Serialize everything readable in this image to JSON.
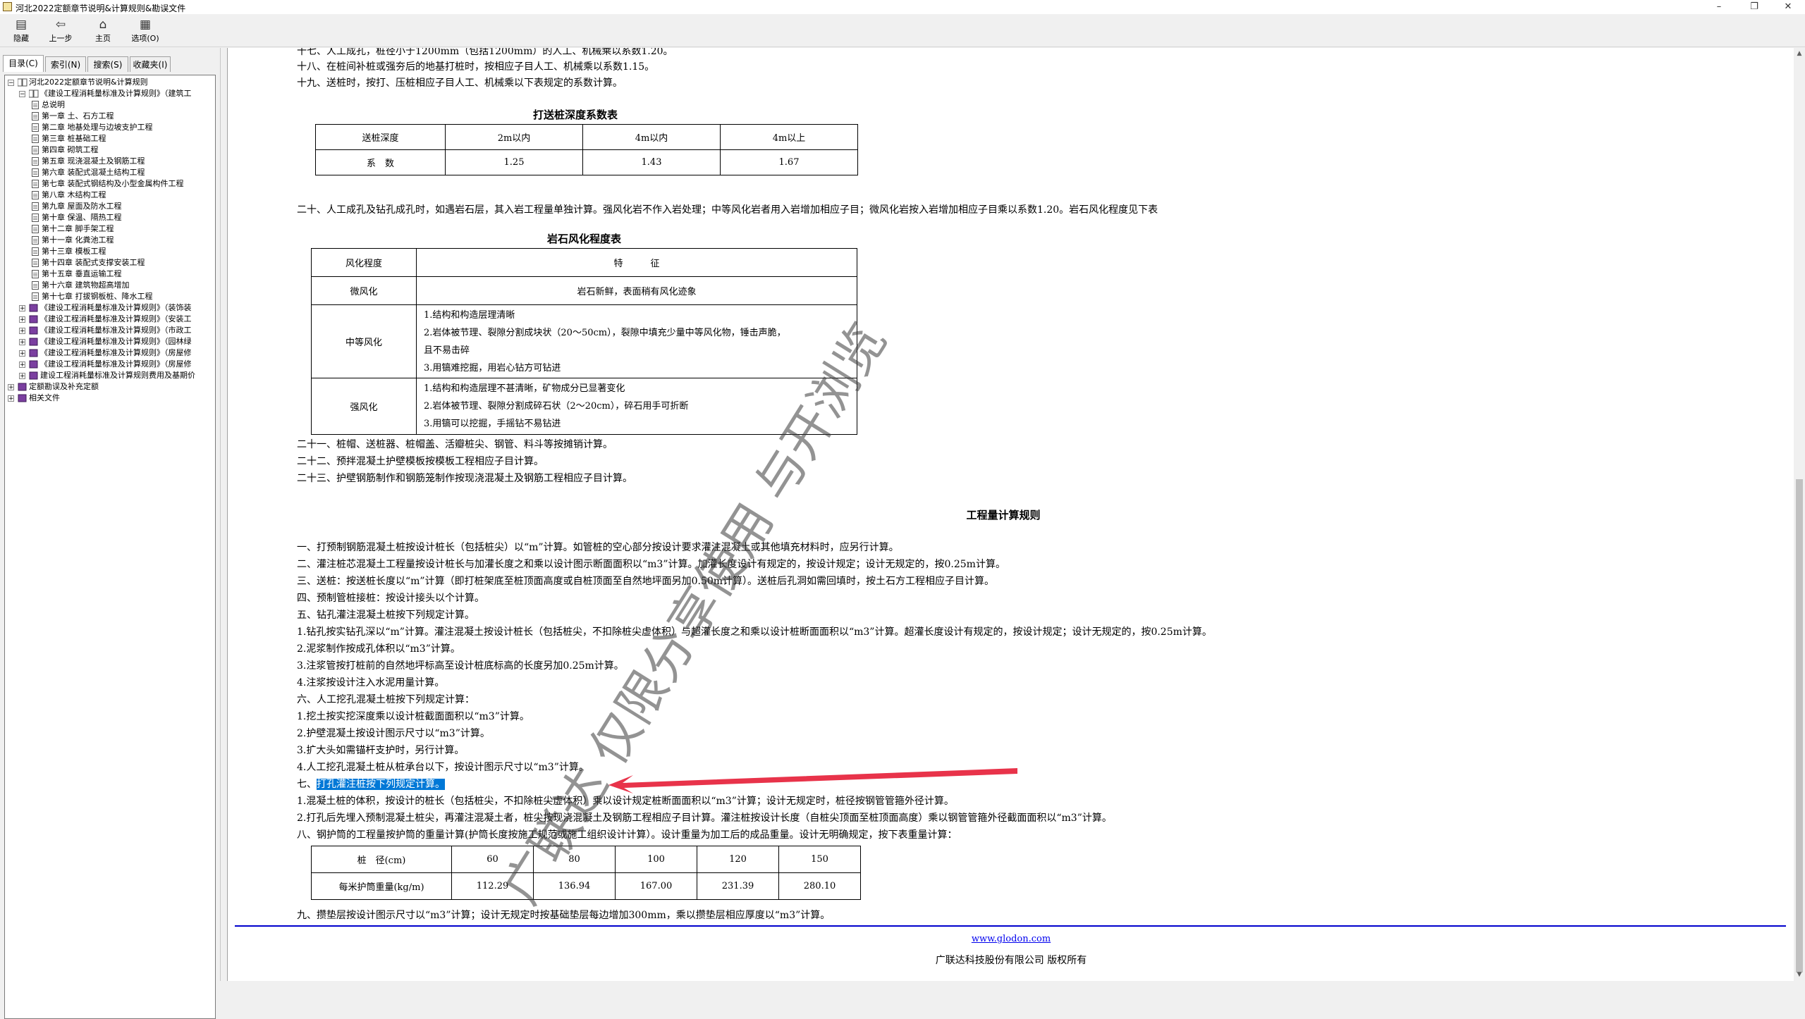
{
  "window": {
    "title": "河北2022定额章节说明&计算规则&勘误文件",
    "minimize": "–",
    "maximize": "❐",
    "close": "✕"
  },
  "toolbar": {
    "items": [
      {
        "label": "隐藏",
        "icon": "hide-icon"
      },
      {
        "label": "上一步",
        "icon": "back-icon"
      },
      {
        "label": "主页",
        "icon": "home-icon"
      },
      {
        "label": "选项(O)",
        "icon": "options-icon"
      }
    ]
  },
  "tabs": [
    "目录(C)",
    "索引(N)",
    "搜索(S)",
    "收藏夹(I)"
  ],
  "tree": {
    "root": "河北2022定额章节说明&计算规则",
    "book1": "《建设工程消耗量标准及计算规则》（建筑工",
    "chapters": [
      "总说明",
      "第一章 土、石方工程",
      "第二章 地基处理与边坡支护工程",
      "第三章 桩基础工程",
      "第四章 砌筑工程",
      "第五章 现浇混凝土及钢筋工程",
      "第六章 装配式混凝土结构工程",
      "第七章 装配式钢结构及小型金属构件工程",
      "第八章 木结构工程",
      "第九章 屋面及防水工程",
      "第十章 保温、隔热工程",
      "第十二章 脚手架工程",
      "第十一章 化粪池工程",
      "第十三章 模板工程",
      "第十四章 装配式支撑安装工程",
      "第十五章 垂直运输工程",
      "第十六章 建筑物超高增加",
      "第十七章 打拔钢板桩、降水工程"
    ],
    "books": [
      "《建设工程消耗量标准及计算规则》（装饰装",
      "《建设工程消耗量标准及计算规则》（安装工",
      "《建设工程消耗量标准及计算规则》（市政工",
      "《建设工程消耗量标准及计算规则》（园林绿",
      "《建设工程消耗量标准及计算规则》（房屋修",
      "《建设工程消耗量标准及计算规则》（房屋修",
      "建设工程消耗量标准及计算规则费用及基期价"
    ],
    "others": [
      "定额勘误及补充定额",
      "相关文件"
    ]
  },
  "doc": {
    "l17": "十七、人工成孔，桩径小于1200mm（包括1200mm）的人工、机械乘以系数1.20。",
    "l18": "十八、在桩间补桩或强夯后的地基打桩时，按相应子目人工、机械乘以系数1.15。",
    "l19": "十九、送桩时，按打、压桩相应子目人工、机械乘以下表规定的系数计算。",
    "table1_title": "打送桩深度系数表",
    "table1": {
      "header": [
        "送桩深度",
        "2m以内",
        "4m以内",
        "4m以上"
      ],
      "row": [
        "系　数",
        "1.25",
        "1.43",
        "1.67"
      ]
    },
    "l20": "二十、人工成孔及钻孔成孔时，如遇岩石层，其入岩工程量单独计算。强风化岩不作入岩处理；中等风化岩者用入岩增加相应子目；微风化岩按入岩增加相应子目乘以系数1.20。岩石风化程度见下表",
    "table2_title": "岩石风化程度表",
    "table2": {
      "header": [
        "风化程度",
        "特　　　征"
      ],
      "r1": [
        "微风化",
        "岩石新鲜，表面稍有风化迹象"
      ],
      "r2_label": "中等风化",
      "r2_lines": [
        "1.结构和构造层理清晰",
        "2.岩体被节理、裂隙分割成块状（20～50cm），裂隙中填充少量中等风化物，锤击声脆，",
        "且不易击碎",
        "3.用镐难挖掘，用岩心钻方可钻进"
      ],
      "r3_label": "强风化",
      "r3_lines": [
        "1.结构和构造层理不甚清晰，矿物成分已显著变化",
        "2.岩体被节理、裂隙分割成碎石状（2～20cm），碎石用手可折断",
        "3.用镐可以挖掘，手摇钻不易钻进"
      ]
    },
    "l21": "二十一、桩帽、送桩器、桩帽盖、活瓣桩尖、钢管、料斗等按摊销计算。",
    "l22": "二十二、预拌混凝土护壁模板按模板工程相应子目计算。",
    "l23": "二十三、护壁钢筋制作和钢筋笼制作按现浇混凝土及钢筋工程相应子目计算。",
    "rules_title": "工程量计算规则",
    "r1": "一、打预制钢筋混凝土桩按设计桩长（包括桩尖）以“m”计算。如管桩的空心部分按设计要求灌注混凝土或其他填充材料时，应另行计算。",
    "r2": "二、灌注桩芯混凝土工程量按设计桩长与加灌长度之和乘以设计图示断面面积以“m3”计算。加灌长度设计有规定的，按设计规定；设计无规定的，按0.25m计算。",
    "r3": "三、送桩：按送桩长度以“m”计算（即打桩架底至桩顶面高度或自桩顶面至自然地坪面另加0.50m计算）。送桩后孔洞如需回填时，按土石方工程相应子目计算。",
    "r4": "四、预制管桩接桩：按设计接头以个计算。",
    "r5": "五、钻孔灌注混凝土桩按下列规定计算。",
    "r5_1": "1.钻孔按实钻孔深以“m”计算。灌注混凝土按设计桩长（包括桩尖，不扣除桩尖虚体积）与超灌长度之和乘以设计桩断面面积以“m3”计算。超灌长度设计有规定的，按设计规定；设计无规定的，按0.25m计算。",
    "r5_2": "2.泥浆制作按成孔体积以“m3”计算。",
    "r5_3": "3.注浆管按打桩前的自然地坪标高至设计桩底标高的长度另加0.25m计算。",
    "r5_4": "4.注浆按设计注入水泥用量计算。",
    "r6": "六、人工挖孔混凝土桩按下列规定计算：",
    "r6_1": "1.挖土按实挖深度乘以设计桩截面面积以“m3”计算。",
    "r6_2": "2.护壁混凝土按设计图示尺寸以“m3”计算。",
    "r6_3": "3.扩大头如需锚杆支护时，另行计算。",
    "r6_4": "4.人工挖孔混凝土桩从桩承台以下，按设计图示尺寸以“m3”计算。",
    "r7_prefix": "七、",
    "r7_hl": "打孔灌注桩按下列规定计算。",
    "r7_1": "1.混凝土桩的体积，按设计的桩长（包括桩尖，不扣除桩尖虚体积）乘以设计规定桩断面面积以“m3”计算；设计无规定时，桩径按钢管管箍外径计算。",
    "r7_2": "2.打孔后先埋入预制混凝土桩尖，再灌注混凝土者，桩尖按现浇混凝土及钢筋工程相应子目计算。灌注桩按设计长度（自桩尖顶面至桩顶面高度）乘以钢管管箍外径截面面积以“m3”计算。",
    "r8": "八、钢护筒的工程量按护筒的重量计算(护筒长度按施工规范或施工组织设计计算）。设计重量为加工后的成品重量。设计无明确规定，按下表重量计算：",
    "table3": {
      "header": [
        "桩　径(cm)",
        "60",
        "80",
        "100",
        "120",
        "150"
      ],
      "row": [
        "每米护筒重量(kg/m)",
        "112.29",
        "136.94",
        "167.00",
        "231.39",
        "280.10"
      ]
    },
    "r9": "九、攒垫层按设计图示尺寸以“m3”计算；设计无规定时按基础垫层每边增加300mm，乘以攒垫层相应厚度以“m3”计算。",
    "footer_link": "www.glodon.com",
    "footer_copy": "广联达科技股份有限公司  版权所有",
    "watermark": "广联达 仅限分享使用 与开浏览"
  },
  "colors": {
    "highlight": "#0078d7",
    "arrow": "#e8334a",
    "footer_rule": "#0000cc"
  }
}
